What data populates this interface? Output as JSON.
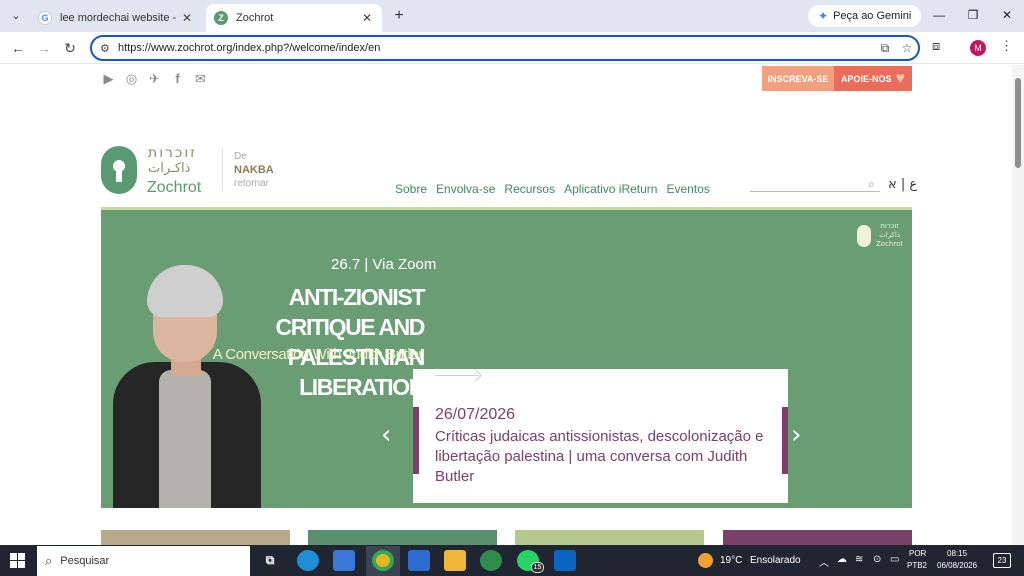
{
  "browser": {
    "tabs": [
      {
        "label": "lee mordechai website - Pesqui",
        "favicon": "G"
      },
      {
        "label": "Zochrot",
        "favicon": "Z"
      }
    ],
    "tab_close": "✕",
    "new_tab": "+",
    "gemini_label": "Peça ao Gemini",
    "url": "https://www.zochrot.org/index.php?/welcome/index/en",
    "profile_initial": "M",
    "window_controls": {
      "minimize": "—",
      "restore": "❐",
      "close": "✕"
    }
  },
  "site": {
    "top_buttons": {
      "subscribe": "INSCREVA-SE",
      "support": "APOIE-NOS"
    },
    "social_icons": [
      "youtube-icon",
      "instagram-icon",
      "twitter-icon",
      "facebook-icon",
      "mail-icon"
    ],
    "logo": {
      "hebrew": "זוכרות",
      "arabic": "ذاكـرات",
      "english": "Zochrot"
    },
    "tagline": {
      "line1": "De",
      "line2": "NAKBA",
      "line3": "retornar"
    },
    "nav": [
      "Sobre",
      "Envolva-se",
      "Recursos",
      "Aplicativo iReturn",
      "Eventos"
    ],
    "language_toggle": "ع | א",
    "hero": {
      "small_logo_hebrew": "זוכרות",
      "small_logo_arabic": "ذاكرات",
      "small_logo_english": "Zochrot",
      "date_line": "26.7 | Via Zoom",
      "title": "ANTI-ZIONIST CRITIQUE AND PALESTINIAN LIBERATION",
      "subtitle": "A Conversation With Judith Butler",
      "card_date": "26/07/2026",
      "card_text": "Críticas judaicas antissionistas, descolonização e libertação palestina | uma conversa com Judith Butler",
      "prev_arrow": "‹",
      "next_arrow": "›"
    },
    "tile_colors": [
      "#b7a98a",
      "#5a8f6d",
      "#b5c98c",
      "#7b3f69"
    ]
  },
  "taskbar": {
    "search_placeholder": "Pesquisar",
    "whatsapp_badge": "15",
    "weather_temp": "19°C",
    "weather_desc": "Ensolarado",
    "lang_line1": "POR",
    "lang_line2": "PTB2",
    "time": "08:15",
    "date": "06/08/2026",
    "notification_count": "23"
  },
  "colors": {
    "brand_green": "#5a9a72",
    "hero_bg": "#6a9d73",
    "accent_purple": "#7b3f69",
    "subscribe_btn": "#f2a07f",
    "support_btn": "#e96d5a"
  }
}
